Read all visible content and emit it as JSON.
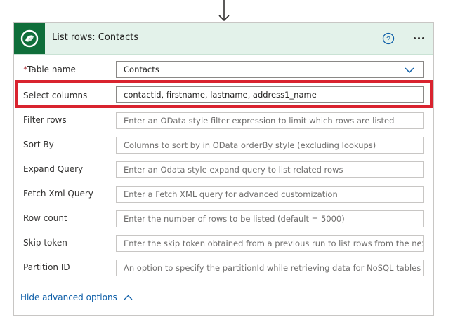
{
  "card": {
    "title": "List rows: Contacts",
    "logo_icon": "dataverse-logo-icon",
    "help_icon": "help-circle-icon",
    "more_icon": "more-options-icon"
  },
  "fields": [
    {
      "label": "Table name",
      "required_mark": "*",
      "value": "Contacts",
      "kind": "select"
    },
    {
      "label": "Select columns",
      "value": "contactid, firstname, lastname, address1_name",
      "kind": "value"
    },
    {
      "label": "Filter rows",
      "placeholder": "Enter an OData style filter expression to limit which rows are listed"
    },
    {
      "label": "Sort By",
      "placeholder": "Columns to sort by in OData orderBy style (excluding lookups)"
    },
    {
      "label": "Expand Query",
      "placeholder": "Enter an Odata style expand query to list related rows"
    },
    {
      "label": "Fetch Xml Query",
      "placeholder": "Enter a Fetch XML query for advanced customization"
    },
    {
      "label": "Row count",
      "placeholder": "Enter the number of rows to be listed (default = 5000)"
    },
    {
      "label": "Skip token",
      "placeholder": "Enter the skip token obtained from a previous run to list rows from the next page"
    },
    {
      "label": "Partition ID",
      "placeholder": "An option to specify the partitionId while retrieving data for NoSQL tables"
    }
  ],
  "advanced": {
    "label": "Hide advanced options",
    "icon": "chevron-up-icon"
  },
  "colors": {
    "header_bg": "#e3f2ea",
    "logo_bg": "#0f6e3a",
    "highlight": "#d9232f",
    "link": "#0f5fa8"
  }
}
